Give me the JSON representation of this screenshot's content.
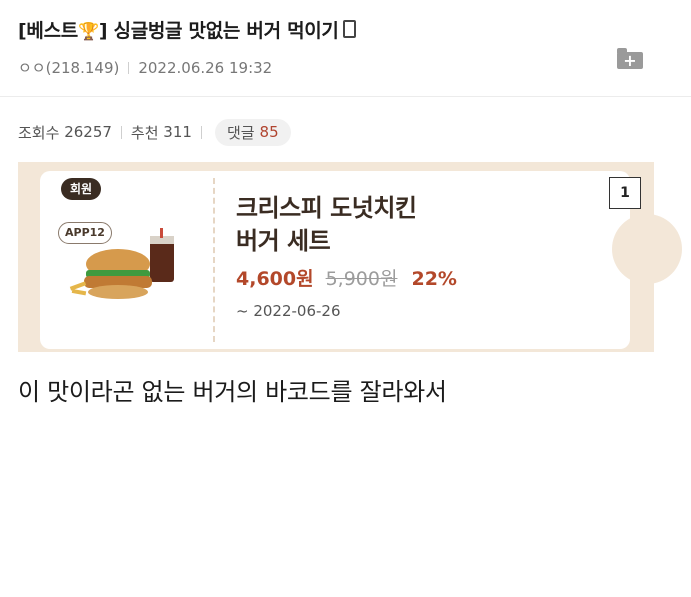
{
  "post": {
    "title": "[베스트🏆] 싱글벙글 맛없는 버거 먹이기",
    "title_prefix": "[베스트",
    "title_trophy": "🏆",
    "title_main": "] 싱글벙글 맛없는 버거 먹이기",
    "author": "ㅇㅇ(218.149)",
    "datetime": "2022.06.26 19:32",
    "views_label": "조회수",
    "views": "26257",
    "recommend_label": "추천",
    "recommend": "311",
    "comments_label": "댓글",
    "comments": "85",
    "body_text": "이 맛이라곤 없는 버거의 바코드를 잘라와서"
  },
  "coupon": {
    "member_badge": "회원",
    "app_badge": "APP12",
    "title_line1": "크리스피 도넛치킨",
    "title_line2": "버거 세트",
    "price": "4,600원",
    "original_price": "5,900원",
    "discount": "22%",
    "expiry": "~ 2022-06-26",
    "quantity": "1"
  },
  "colors": {
    "accent_price": "#b3482a",
    "coupon_bg": "#f3e7d8",
    "badge_dark": "#3a2c22"
  }
}
